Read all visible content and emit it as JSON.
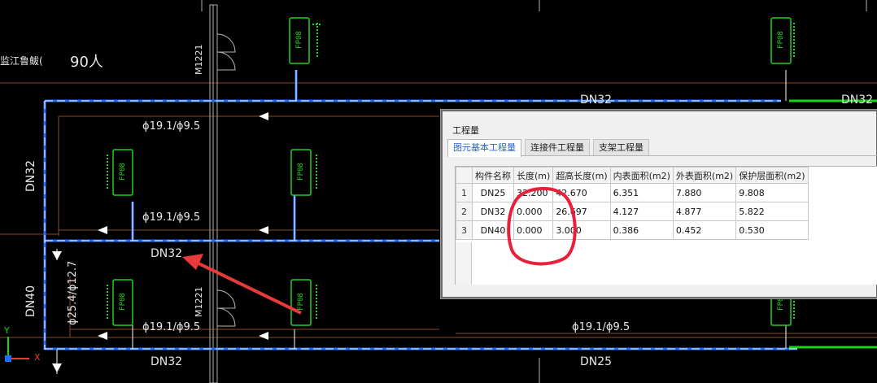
{
  "cad": {
    "top_left_text": "监江鲁鲅(",
    "ninety_text": "90人",
    "door_label_top": "M1221",
    "door_label_bottom": "M1221",
    "pipe_labels": [
      "DN32",
      "DN32",
      "DN32",
      "DN32",
      "DN25",
      "DN32",
      "DN40",
      "DN32"
    ],
    "size_labels": [
      "ɸ19.1/ɸ9.5",
      "ɸ19.1/ɸ9.5",
      "ɸ19.1/ɸ9.5",
      "ɸ19.1/ɸ9.5",
      "ɸ25.4/ɸ12.7"
    ],
    "fp_unit_label": "FP08",
    "axis_x": "X",
    "axis_y": "Y",
    "colors": {
      "pipe_blue": "#1e6fff",
      "pipe_green": "#16d616",
      "wall": "#8a4a28",
      "unit_green": "#22d122",
      "arrow_red": "#e83a3a"
    }
  },
  "panel": {
    "title": "工程量",
    "tabs": [
      "图元基本工程量",
      "连接件工程量",
      "支架工程量"
    ],
    "active_tab": 0,
    "columns": [
      "构件名称",
      "长度(m)",
      "超高长度(m)",
      "内表面积(m2)",
      "外表面积(m2)",
      "保护层面积(m2)"
    ],
    "rows": [
      {
        "num": "1",
        "cells": [
          "DN25",
          "32.200",
          "42.670",
          "6.351",
          "7.880",
          "9.808"
        ]
      },
      {
        "num": "2",
        "cells": [
          "DN32",
          "0.000",
          "26.697",
          "4.127",
          "4.877",
          "5.822"
        ]
      },
      {
        "num": "3",
        "cells": [
          "DN40",
          "0.000",
          "3.000",
          "0.386",
          "0.452",
          "0.530"
        ]
      }
    ]
  }
}
